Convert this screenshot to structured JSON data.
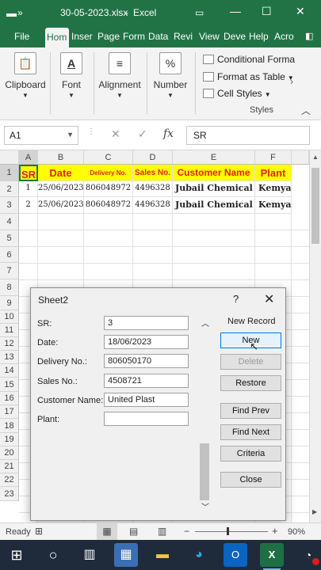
{
  "titlebar": {
    "filename": "30-05-2023.xlsx",
    "separator": "-",
    "app": "Excel",
    "save_icon": "save-icon",
    "undo_icon": "undo-icon",
    "redo_icon": "redo-icon",
    "customize_icon": "chevron-down-icon",
    "restore_icon": "ribbon-display-icon",
    "minimize": "—",
    "maximize": "☐",
    "close": "✕"
  },
  "tabs": [
    "File",
    "Hom",
    "Inser",
    "Page",
    "Form",
    "Data",
    "Revi",
    "View",
    "Deve",
    "Help",
    "Acro"
  ],
  "ribbon": {
    "clipboard": "Clipboard",
    "font": "Font",
    "alignment": "Alignment",
    "number": "Number",
    "conditional_formatting": "Conditional Forma",
    "format_as_table": "Format as Table",
    "cell_styles": "Cell Styles",
    "styles_group": "Styles",
    "font_icon_glyph": "A",
    "number_icon_glyph": "%"
  },
  "formula_bar": {
    "name_box": "A1",
    "cancel_glyph": "✕",
    "enter_glyph": "✓",
    "fx_glyph": "fx",
    "formula": "SR"
  },
  "grid": {
    "columns": [
      "A",
      "B",
      "C",
      "D",
      "E",
      "F"
    ],
    "rows": [
      "1",
      "2",
      "3",
      "4",
      "5",
      "6",
      "7",
      "8",
      "9",
      "10",
      "11",
      "12",
      "13",
      "14",
      "15",
      "16",
      "17",
      "18",
      "19",
      "20",
      "21",
      "22",
      "23"
    ],
    "header": [
      "SR",
      "Date",
      "Delivery No.",
      "Sales No.",
      "Customer Name",
      "Plant"
    ],
    "data": [
      [
        "1",
        "25/06/2023",
        "806048972",
        "4496328",
        "Jubail Chemical In",
        "Kemya"
      ],
      [
        "2",
        "25/06/2023",
        "806048972",
        "4496328",
        "Jubail Chemical In",
        "Kemya"
      ]
    ]
  },
  "dialog": {
    "title": "Sheet2",
    "help": "?",
    "close": "✕",
    "record_status": "New Record",
    "fields": [
      {
        "label": "SR:",
        "value": "3"
      },
      {
        "label": "Date:",
        "value": "18/06/2023"
      },
      {
        "label": "Delivery No.:",
        "value": "806050170"
      },
      {
        "label": "Sales No.:",
        "value": "4508721"
      },
      {
        "label": "Customer Name:",
        "value": "United Plast"
      },
      {
        "label": "Plant:",
        "value": ""
      }
    ],
    "buttons": {
      "new": "New",
      "delete": "Delete",
      "restore": "Restore",
      "find_prev": "Find Prev",
      "find_next": "Find Next",
      "criteria": "Criteria",
      "close": "Close"
    }
  },
  "status_bar": {
    "ready": "Ready",
    "zoom_minus": "−",
    "zoom_plus": "+",
    "zoom": "90%"
  },
  "colors": {
    "excel_green": "#217346",
    "header_fill": "#ffff00",
    "header_text": "#e02020",
    "taskbar": "#1f2b3a"
  }
}
